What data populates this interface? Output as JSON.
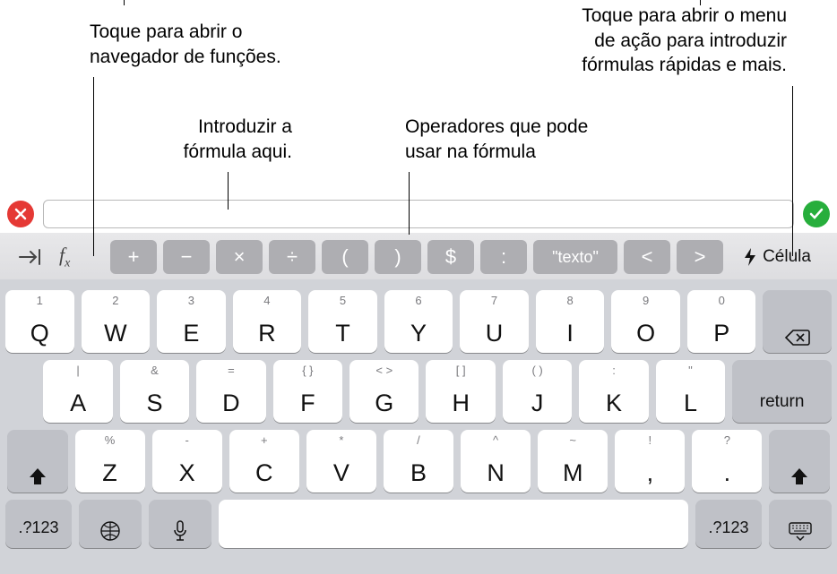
{
  "callouts": {
    "fx": "Toque para abrir o\nnavegador de funções.",
    "input": "Introduzir a\nfórmula aqui.",
    "operators": "Operadores que pode\nusar na fórmula",
    "cell": "Toque para abrir o menu\nde ação para introduzir\nfórmulas rápidas e mais."
  },
  "toolbar": {
    "fx_label": "fx",
    "operators": [
      "+",
      "−",
      "×",
      "÷",
      "(",
      ")",
      "$",
      ":"
    ],
    "text_operator": "\"texto\"",
    "compare": [
      "<",
      ">"
    ],
    "cell_label": "Célula"
  },
  "keyboard": {
    "row0": [
      {
        "alt": "1",
        "main": "Q"
      },
      {
        "alt": "2",
        "main": "W"
      },
      {
        "alt": "3",
        "main": "E"
      },
      {
        "alt": "4",
        "main": "R"
      },
      {
        "alt": "5",
        "main": "T"
      },
      {
        "alt": "6",
        "main": "Y"
      },
      {
        "alt": "7",
        "main": "U"
      },
      {
        "alt": "8",
        "main": "I"
      },
      {
        "alt": "9",
        "main": "O"
      },
      {
        "alt": "0",
        "main": "P"
      }
    ],
    "row1": [
      {
        "alt": "|",
        "main": "A"
      },
      {
        "alt": "&",
        "main": "S"
      },
      {
        "alt": "=",
        "main": "D"
      },
      {
        "alt": "{  }",
        "main": "F"
      },
      {
        "alt": "<  >",
        "main": "G"
      },
      {
        "alt": "[  ]",
        "main": "H"
      },
      {
        "alt": "(  )",
        "main": "J"
      },
      {
        "alt": ":",
        "main": "K"
      },
      {
        "alt": "\"",
        "main": "L"
      }
    ],
    "row2": [
      {
        "alt": "%",
        "main": "Z"
      },
      {
        "alt": "-",
        "main": "X"
      },
      {
        "alt": "+",
        "main": "C"
      },
      {
        "alt": "*",
        "main": "V"
      },
      {
        "alt": "/",
        "main": "B"
      },
      {
        "alt": "^",
        "main": "N"
      },
      {
        "alt": "~",
        "main": "M"
      },
      {
        "alt": "!",
        "main": ","
      },
      {
        "alt": "?",
        "main": "."
      }
    ],
    "return_label": "return",
    "sym_label": ".?123"
  }
}
